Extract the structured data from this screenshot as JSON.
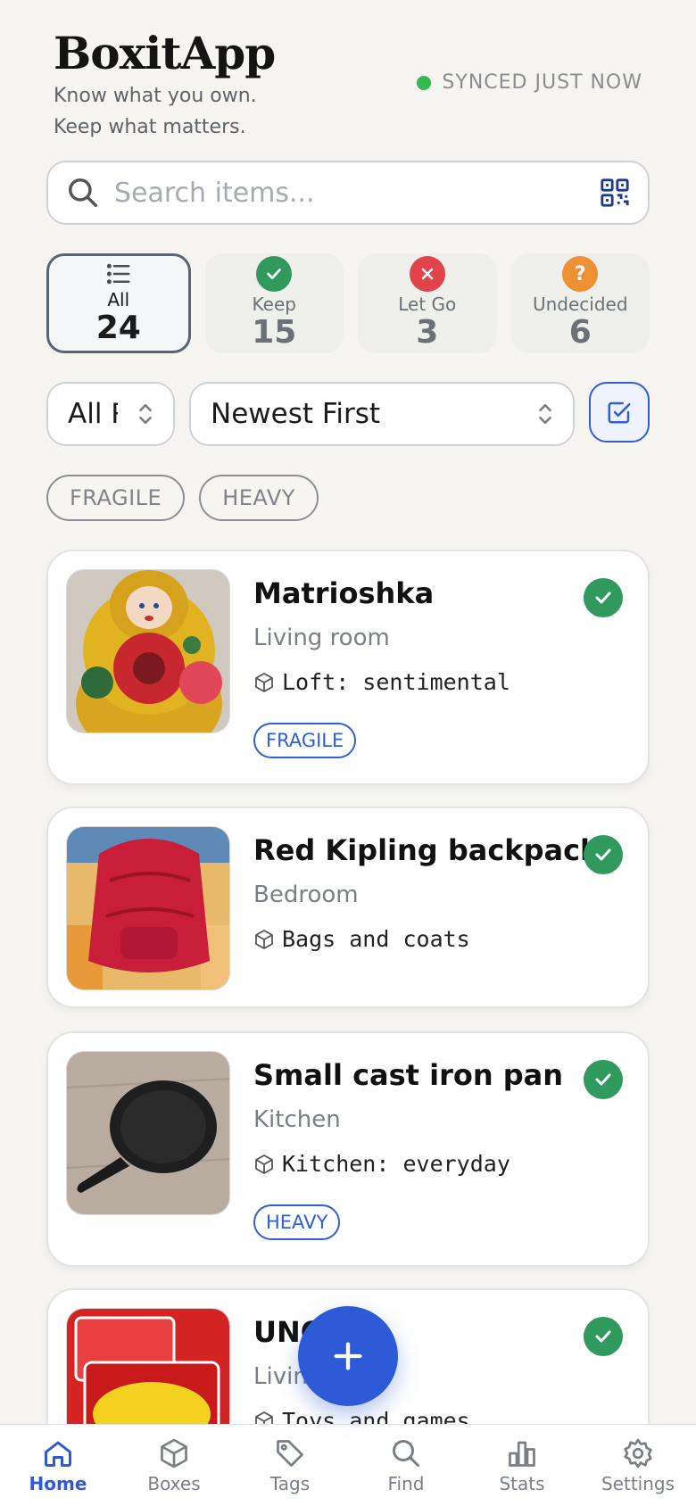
{
  "app": {
    "title": "BoxitApp",
    "tagline_line1": "Know what you own.",
    "tagline_line2": "Keep what matters.",
    "sync_status": "SYNCED JUST NOW"
  },
  "search": {
    "placeholder": "Search items..."
  },
  "status_filters": [
    {
      "label": "All",
      "count": "24",
      "icon": "list-icon",
      "active": true
    },
    {
      "label": "Keep",
      "count": "15",
      "icon": "check-icon",
      "color": "#2f9a5b"
    },
    {
      "label": "Let Go",
      "count": "3",
      "icon": "x-icon",
      "color": "#e0444a"
    },
    {
      "label": "Undecided",
      "count": "6",
      "icon": "question-icon",
      "color": "#ee9135"
    }
  ],
  "room_select": {
    "value": "All Rooms"
  },
  "sort_select": {
    "value": "Newest First"
  },
  "tag_chips": [
    "FRAGILE",
    "HEAVY"
  ],
  "items": [
    {
      "name": "Matrioshka",
      "room": "Living room",
      "box": "Loft: sentimental",
      "tag": "FRAGILE",
      "status": "keep"
    },
    {
      "name": "Red Kipling backpack",
      "room": "Bedroom",
      "box": "Bags and coats",
      "status": "keep"
    },
    {
      "name": "Small cast iron pan",
      "room": "Kitchen",
      "box": "Kitchen: everyday",
      "tag": "HEAVY",
      "status": "keep"
    },
    {
      "name": "UNO",
      "room": "Living room",
      "box": "Toys and games",
      "status": "keep"
    }
  ],
  "bottom_nav": [
    {
      "label": "Home",
      "icon": "home-icon",
      "active": true
    },
    {
      "label": "Boxes",
      "icon": "box-icon"
    },
    {
      "label": "Tags",
      "icon": "tag-icon"
    },
    {
      "label": "Find",
      "icon": "search-icon"
    },
    {
      "label": "Stats",
      "icon": "chart-icon"
    },
    {
      "label": "Settings",
      "icon": "gear-icon"
    }
  ],
  "colors": {
    "accent": "#2d5bd7",
    "keep": "#2f9a5b",
    "let_go": "#e0444a",
    "undecided": "#ee9135",
    "synced": "#35b84f"
  }
}
